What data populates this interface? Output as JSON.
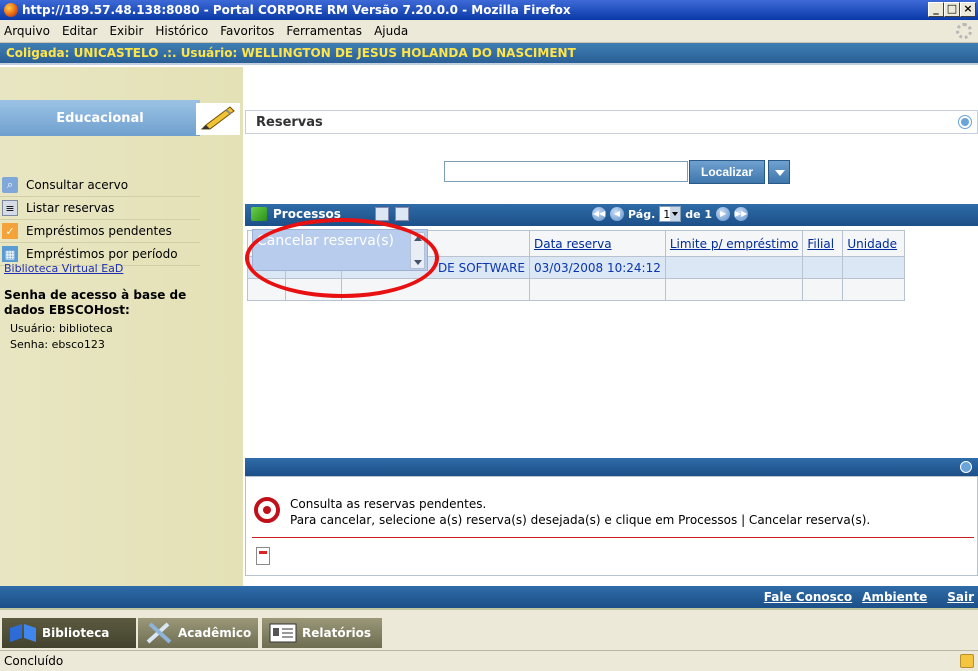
{
  "window": {
    "title": "http://189.57.48.138:8080 - Portal CORPORE RM Versão 7.20.0.0 - Mozilla Firefox",
    "buttons": [
      "_",
      "□",
      "×"
    ]
  },
  "menu": [
    "Arquivo",
    "Editar",
    "Exibir",
    "Histórico",
    "Favoritos",
    "Ferramentas",
    "Ajuda"
  ],
  "infobar": "Coligada: UNICASTELO .:. Usuário: WELLINGTON DE JESUS HOLANDA DO NASCIMENT",
  "sidebar": {
    "title": "Educacional",
    "items": [
      {
        "label": "Consultar acervo",
        "icon": "search-icon"
      },
      {
        "label": "Listar reservas",
        "icon": "list-icon"
      },
      {
        "label": "Empréstimos pendentes",
        "icon": "check-icon"
      },
      {
        "label": "Empréstimos por período",
        "icon": "calendar-icon"
      }
    ],
    "link": "Biblioteca Virtual EaD",
    "senha_title": "Senha de acesso à base de dados EBSCOHost:",
    "usuario": "Usuário: biblioteca",
    "senha": "Senha: ebsco123"
  },
  "main": {
    "title": "Reservas",
    "search": {
      "value": "",
      "button": "Localizar"
    },
    "toolbar": {
      "processos": "Processos",
      "pag_label": "Pág.",
      "page": "1",
      "of_label": "de 1"
    },
    "popup_item": "Cancelar reserva(s)",
    "columns": [
      "",
      "",
      "",
      "Data reserva",
      "Limite p/ empréstimo",
      "Filial",
      "Unidade"
    ],
    "rows": [
      {
        "c1": "",
        "c2": "",
        "c3": "DE SOFTWARE",
        "data": "03/03/2008 10:24:12",
        "limite": "",
        "filial": "",
        "unidade": ""
      }
    ],
    "help_line1": "Consulta as reservas pendentes.",
    "help_line2": "Para cancelar, selecione a(s) reserva(s) desejada(s) e clique em Processos | Cancelar reserva(s)."
  },
  "footer": {
    "links": [
      "Fale Conosco",
      "Ambiente",
      "Sair"
    ],
    "modules": [
      "Biblioteca",
      "Acadêmico",
      "Relatórios"
    ]
  },
  "status": "Concluído",
  "colors": {
    "accent": "#2f6ca8",
    "info_text": "#ffe44a",
    "highlight": "#e81010"
  }
}
